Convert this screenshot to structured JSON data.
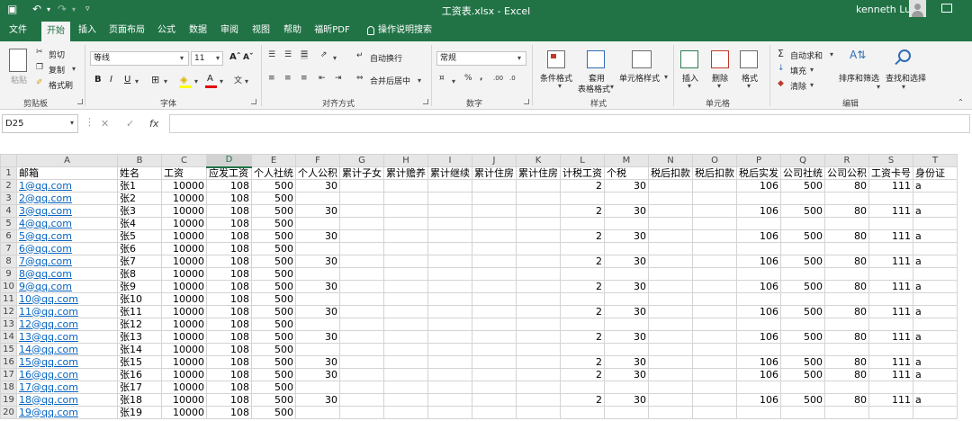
{
  "window": {
    "title": "工资表.xlsx - Excel",
    "user": "kenneth Lu"
  },
  "tabs": [
    {
      "label": "文件",
      "active": false
    },
    {
      "label": "开始",
      "active": true
    },
    {
      "label": "插入",
      "active": false
    },
    {
      "label": "页面布局",
      "active": false
    },
    {
      "label": "公式",
      "active": false
    },
    {
      "label": "数据",
      "active": false
    },
    {
      "label": "审阅",
      "active": false
    },
    {
      "label": "视图",
      "active": false
    },
    {
      "label": "帮助",
      "active": false
    },
    {
      "label": "福昕PDF",
      "active": false
    }
  ],
  "tell_me": "操作说明搜索",
  "ribbon": {
    "clipboard": {
      "group": "剪贴板",
      "paste": "粘贴",
      "cut": "剪切",
      "copy": "复制",
      "format_painter": "格式刷"
    },
    "font": {
      "group": "字体",
      "name": "等线",
      "size": "11"
    },
    "alignment": {
      "group": "对齐方式",
      "wrap": "自动换行",
      "merge": "合并后居中"
    },
    "number": {
      "group": "数字",
      "format": "常规"
    },
    "styles": {
      "group": "样式",
      "conditional": "条件格式",
      "table_line1": "套用",
      "table_line2": "表格格式",
      "cell": "单元格样式"
    },
    "cells": {
      "group": "单元格",
      "insert": "插入",
      "delete": "删除",
      "format": "格式"
    },
    "editing": {
      "group": "编辑",
      "autosum": "自动求和",
      "fill": "填充",
      "clear": "清除",
      "sort": "排序和筛选",
      "find": "查找和选择"
    }
  },
  "formula_bar": {
    "name_box": "D25",
    "fx": "fx",
    "value": ""
  },
  "sheet": {
    "selected_column": "D",
    "columns": [
      "A",
      "B",
      "C",
      "D",
      "E",
      "F",
      "G",
      "H",
      "I",
      "J",
      "K",
      "L",
      "M",
      "N",
      "O",
      "P",
      "Q",
      "R",
      "S",
      "T"
    ],
    "rows": [
      [
        "邮箱",
        "姓名",
        "工资",
        "应发工资",
        "个人社统",
        "个人公积",
        "累计子女",
        "累计赡养",
        "累计继续",
        "累计住房",
        "累计住房",
        "计税工资",
        "个税",
        "税后扣款",
        "税后扣款",
        "税后实发",
        "公司社统",
        "公司公积",
        "工资卡号",
        "身份证"
      ],
      [
        "1@qq.com",
        "张1",
        "10000",
        "108",
        "500",
        "30",
        "",
        "",
        "",
        "",
        "",
        "2",
        "30",
        "",
        "",
        "106",
        "500",
        "80",
        "111",
        "a"
      ],
      [
        "2@qq.com",
        "张2",
        "10000",
        "108",
        "500",
        "",
        "",
        "",
        "",
        "",
        "",
        "",
        "",
        "",
        "",
        "",
        "",
        "",
        "",
        ""
      ],
      [
        "3@qq.com",
        "张3",
        "10000",
        "108",
        "500",
        "30",
        "",
        "",
        "",
        "",
        "",
        "2",
        "30",
        "",
        "",
        "106",
        "500",
        "80",
        "111",
        "a"
      ],
      [
        "4@qq.com",
        "张4",
        "10000",
        "108",
        "500",
        "",
        "",
        "",
        "",
        "",
        "",
        "",
        "",
        "",
        "",
        "",
        "",
        "",
        "",
        ""
      ],
      [
        "5@qq.com",
        "张5",
        "10000",
        "108",
        "500",
        "30",
        "",
        "",
        "",
        "",
        "",
        "2",
        "30",
        "",
        "",
        "106",
        "500",
        "80",
        "111",
        "a"
      ],
      [
        "6@qq.com",
        "张6",
        "10000",
        "108",
        "500",
        "",
        "",
        "",
        "",
        "",
        "",
        "",
        "",
        "",
        "",
        "",
        "",
        "",
        "",
        ""
      ],
      [
        "7@qq.com",
        "张7",
        "10000",
        "108",
        "500",
        "30",
        "",
        "",
        "",
        "",
        "",
        "2",
        "30",
        "",
        "",
        "106",
        "500",
        "80",
        "111",
        "a"
      ],
      [
        "8@qq.com",
        "张8",
        "10000",
        "108",
        "500",
        "",
        "",
        "",
        "",
        "",
        "",
        "",
        "",
        "",
        "",
        "",
        "",
        "",
        "",
        ""
      ],
      [
        "9@qq.com",
        "张9",
        "10000",
        "108",
        "500",
        "30",
        "",
        "",
        "",
        "",
        "",
        "2",
        "30",
        "",
        "",
        "106",
        "500",
        "80",
        "111",
        "a"
      ],
      [
        "10@qq.com",
        "张10",
        "10000",
        "108",
        "500",
        "",
        "",
        "",
        "",
        "",
        "",
        "",
        "",
        "",
        "",
        "",
        "",
        "",
        "",
        ""
      ],
      [
        "11@qq.com",
        "张11",
        "10000",
        "108",
        "500",
        "30",
        "",
        "",
        "",
        "",
        "",
        "2",
        "30",
        "",
        "",
        "106",
        "500",
        "80",
        "111",
        "a"
      ],
      [
        "12@qq.com",
        "张12",
        "10000",
        "108",
        "500",
        "",
        "",
        "",
        "",
        "",
        "",
        "",
        "",
        "",
        "",
        "",
        "",
        "",
        "",
        ""
      ],
      [
        "13@qq.com",
        "张13",
        "10000",
        "108",
        "500",
        "30",
        "",
        "",
        "",
        "",
        "",
        "2",
        "30",
        "",
        "",
        "106",
        "500",
        "80",
        "111",
        "a"
      ],
      [
        "14@qq.com",
        "张14",
        "10000",
        "108",
        "500",
        "",
        "",
        "",
        "",
        "",
        "",
        "",
        "",
        "",
        "",
        "",
        "",
        "",
        "",
        ""
      ],
      [
        "15@qq.com",
        "张15",
        "10000",
        "108",
        "500",
        "30",
        "",
        "",
        "",
        "",
        "",
        "2",
        "30",
        "",
        "",
        "106",
        "500",
        "80",
        "111",
        "a"
      ],
      [
        "16@qq.com",
        "张16",
        "10000",
        "108",
        "500",
        "30",
        "",
        "",
        "",
        "",
        "",
        "2",
        "30",
        "",
        "",
        "106",
        "500",
        "80",
        "111",
        "a"
      ],
      [
        "17@qq.com",
        "张17",
        "10000",
        "108",
        "500",
        "",
        "",
        "",
        "",
        "",
        "",
        "",
        "",
        "",
        "",
        "",
        "",
        "",
        "",
        ""
      ],
      [
        "18@qq.com",
        "张18",
        "10000",
        "108",
        "500",
        "30",
        "",
        "",
        "",
        "",
        "",
        "2",
        "30",
        "",
        "",
        "106",
        "500",
        "80",
        "111",
        "a"
      ],
      [
        "19@qq.com",
        "张19",
        "10000",
        "108",
        "500",
        "",
        "",
        "",
        "",
        "",
        "",
        "",
        "",
        "",
        "",
        "",
        "",
        "",
        "",
        ""
      ]
    ]
  }
}
